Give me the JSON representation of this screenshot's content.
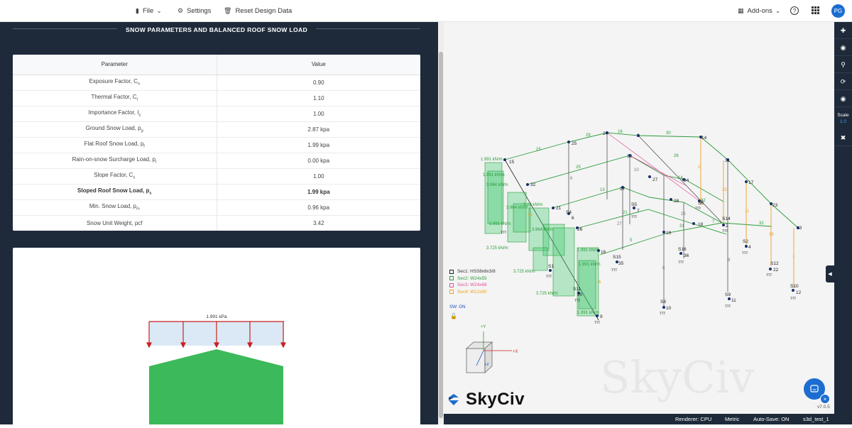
{
  "topbar": {
    "file_label": "File",
    "settings_label": "Settings",
    "reset_label": "Reset Design Data",
    "addons_label": "Add-ons",
    "help_label": "?",
    "avatar_initials": "PG"
  },
  "section": {
    "title": "SNOW PARAMETERS AND BALANCED ROOF SNOW LOAD"
  },
  "table": {
    "headers": [
      "Parameter",
      "Value"
    ],
    "rows": [
      {
        "param": "Exposure Factor, Ce",
        "value": "0.90"
      },
      {
        "param": "Thermal Factor, Ct",
        "value": "1.10"
      },
      {
        "param": "Importance Factor, Is",
        "value": "1.00"
      },
      {
        "param": "Ground Snow Load, pg",
        "value": "2.87 kpa"
      },
      {
        "param": "Flat Roof Snow Load, pf",
        "value": "1.99 kpa"
      },
      {
        "param": "Rain-on-snow Surcharge Load, pr",
        "value": "0.00 kpa"
      },
      {
        "param": "Slope Factor, Cs",
        "value": "1.00"
      },
      {
        "param": "Sloped Roof Snow Load, ps",
        "value": "1.99 kpa"
      },
      {
        "param": "Min. Snow Load, pm",
        "value": "0.96 kpa"
      },
      {
        "param": "Snow Unit Weight, pcf",
        "value": "3.42"
      }
    ]
  },
  "diagram": {
    "load_label": "1.991 kPa",
    "load_color": "#cc1f1f",
    "load_fill": "#dbe9f6",
    "building_color": "#3cb95a"
  },
  "viewer": {
    "legend": [
      {
        "label": "Sec1: HSS8x8x3/8",
        "color": "#222222"
      },
      {
        "label": "Sec2: W24x55",
        "color": "#2a9d3a"
      },
      {
        "label": "Sec3: W24x68",
        "color": "#e0529a"
      },
      {
        "label": "Sec4: W12x50",
        "color": "#f0a020"
      }
    ],
    "sw_label": "SW: ON",
    "logo_text": "SkyCiv",
    "watermark": "SkyCiv",
    "version": "v7.0.5",
    "axis_y": "+Y",
    "axis_x": "+X",
    "axis_z": "+Z",
    "scale_label": "Scale",
    "scale_value": "1.0"
  },
  "status": {
    "renderer": "Renderer: CPU",
    "units": "Metric",
    "autosave": "Auto-Save: ON",
    "filename": "s3d_test_1"
  }
}
